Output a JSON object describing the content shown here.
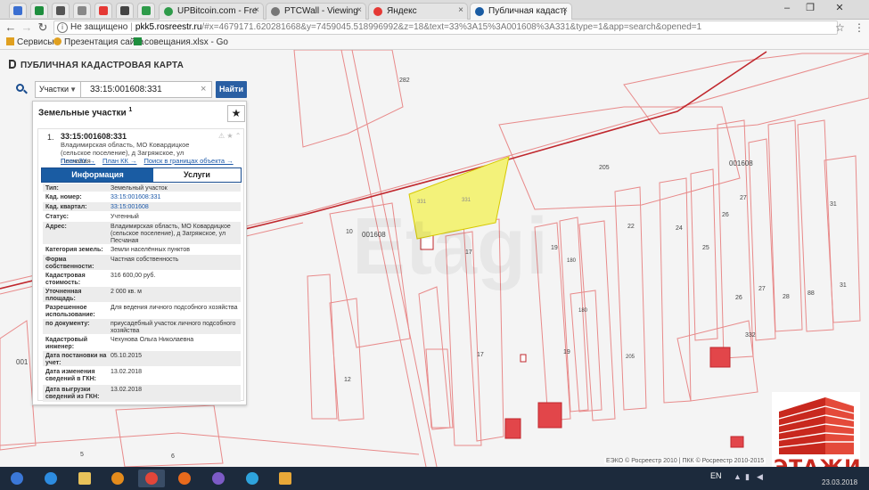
{
  "browser": {
    "tabs": [
      {
        "label": "UPBitcoin.com - Free fa",
        "color": "#2e9b4a"
      },
      {
        "label": "PTCWall - Viewing Adve",
        "color": "#777777"
      },
      {
        "label": "Яндекс",
        "color": "#e53935"
      },
      {
        "label": "Публичная кадастрова",
        "color": "#1a5ca3",
        "active": true
      }
    ],
    "url_security": "Не защищено",
    "url_host": "pkk5.rosreestr.ru",
    "url_path": "/#x=4679171.620281668&y=7459045.518996992&z=18&text=33%3A15%3A001608%3A331&type=1&app=search&opened=1",
    "bookmarks": [
      {
        "label": "Сервисы",
        "color": "#e0a020"
      },
      {
        "label": "Презентация сайта",
        "color": "#e0a020"
      },
      {
        "label": "совещания.xlsx - Go",
        "color": "#1e8e3e"
      }
    ]
  },
  "app": {
    "title": "ПУБЛИЧНАЯ КАДАСТРОВАЯ КАРТА",
    "search": {
      "type": "Участки",
      "query": "33:15:001608:331",
      "button": "Найти"
    },
    "results_title": "Земельные участки",
    "results_count": "1",
    "card": {
      "index": "1.",
      "cadnum": "33:15:001608:331",
      "address": "Владимирская область, МО Ковардицкое (сельское поселение), д Загряжское, ул Песчаная",
      "links": [
        "План ЗУ →",
        "План КК →",
        "Поиск в границах объекта →"
      ],
      "tab_info": "Информация",
      "tab_services": "Услуги",
      "props": [
        {
          "k": "Тип:",
          "v": "Земельный участок"
        },
        {
          "k": "Кад. номер:",
          "v": "33:15:001608:331",
          "link": true
        },
        {
          "k": "Кад. квартал:",
          "v": "33:15:001608",
          "link": true
        },
        {
          "k": "Статус:",
          "v": "Учтенный"
        },
        {
          "k": "Адрес:",
          "v": "Владимирская область, МО Ковардицкое (сельское поселение), д Загряжское, ул Песчаная"
        },
        {
          "k": "Категория земель:",
          "v": "Земли населённых пунктов"
        },
        {
          "k": "Форма собственности:",
          "v": "Частная собственность"
        },
        {
          "k": "Кадастровая стоимость:",
          "v": "316 600,00 руб."
        },
        {
          "k": "Уточненная площадь:",
          "v": "2 000 кв. м"
        },
        {
          "k": "Разрешенное использование:",
          "v": "Для ведения личного подсобного хозяйства"
        },
        {
          "k": "по документу:",
          "v": "приусадебный участок личного подсобного хозяйства"
        },
        {
          "k": "Кадастровый инженер:",
          "v": "Чехунова Ольга Николаевна"
        },
        {
          "k": "Дата постановки на учет:",
          "v": "05.10.2015"
        },
        {
          "k": "Дата изменения сведений в ГКН:",
          "v": "13.02.2018"
        },
        {
          "k": "Дата выгрузки сведений из ГКН:",
          "v": "13.02.2018"
        }
      ]
    }
  },
  "map": {
    "labels": [
      {
        "t": "282"
      },
      {
        "t": "205"
      },
      {
        "t": "001608"
      },
      {
        "t": "001608"
      },
      {
        "t": "331"
      },
      {
        "t": "331"
      },
      {
        "t": "10"
      },
      {
        "t": "17"
      },
      {
        "t": "17"
      },
      {
        "t": "12"
      },
      {
        "t": "19"
      },
      {
        "t": "19"
      },
      {
        "t": "22"
      },
      {
        "t": "24"
      },
      {
        "t": "25"
      },
      {
        "t": "26"
      },
      {
        "t": "26"
      },
      {
        "t": "27"
      },
      {
        "t": "27"
      },
      {
        "t": "28"
      },
      {
        "t": "88"
      },
      {
        "t": "31"
      },
      {
        "t": "31"
      },
      {
        "t": "332"
      },
      {
        "t": "001"
      },
      {
        "t": "6"
      },
      {
        "t": "5"
      },
      {
        "t": "180"
      },
      {
        "t": "180"
      },
      {
        "t": "205"
      }
    ],
    "attribution": "ЕЭКО © Росреестр 2010 | ПКК © Росреестр 2010-2015",
    "watermark": "Etagi",
    "highlight_color": "#f3f27a"
  },
  "logo": {
    "text": "ЭТАЖИ",
    "color": "#c8281e"
  },
  "taskbar": {
    "lang": "EN",
    "clock": "23.03.2018"
  }
}
